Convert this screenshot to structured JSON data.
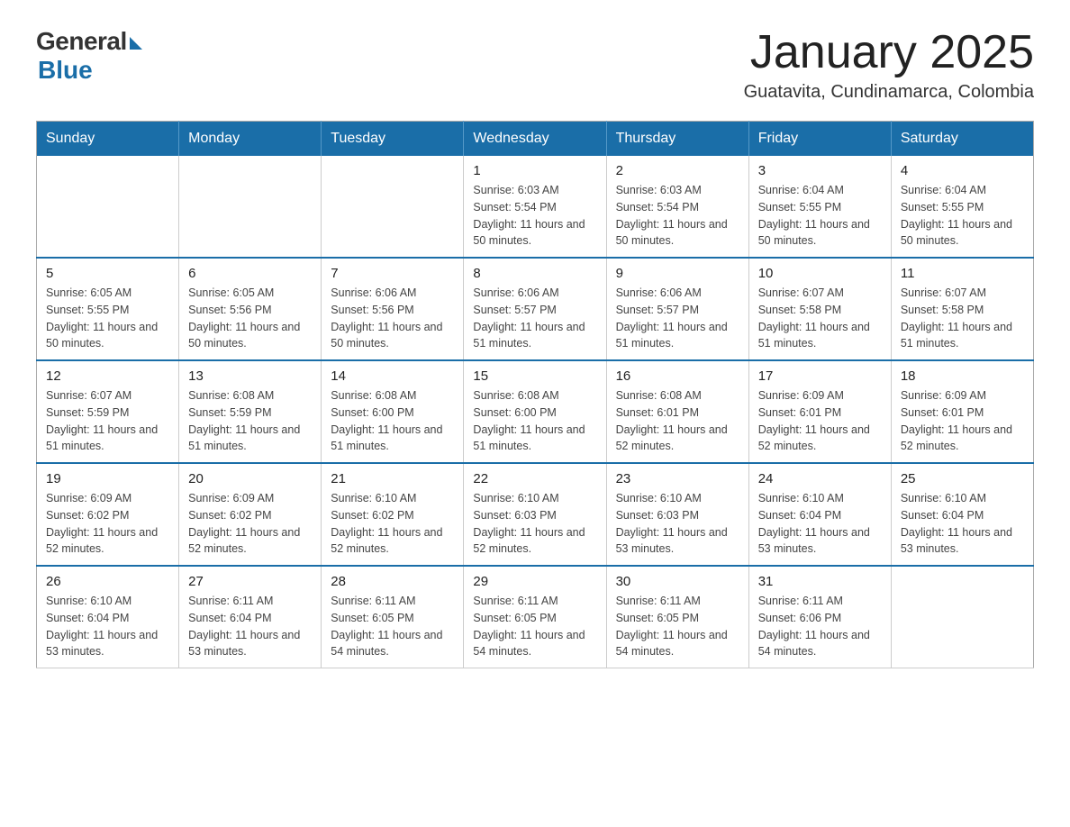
{
  "logo": {
    "general": "General",
    "blue": "Blue"
  },
  "title": "January 2025",
  "subtitle": "Guatavita, Cundinamarca, Colombia",
  "days_of_week": [
    "Sunday",
    "Monday",
    "Tuesday",
    "Wednesday",
    "Thursday",
    "Friday",
    "Saturday"
  ],
  "weeks": [
    [
      {
        "day": "",
        "info": ""
      },
      {
        "day": "",
        "info": ""
      },
      {
        "day": "",
        "info": ""
      },
      {
        "day": "1",
        "info": "Sunrise: 6:03 AM\nSunset: 5:54 PM\nDaylight: 11 hours\nand 50 minutes."
      },
      {
        "day": "2",
        "info": "Sunrise: 6:03 AM\nSunset: 5:54 PM\nDaylight: 11 hours\nand 50 minutes."
      },
      {
        "day": "3",
        "info": "Sunrise: 6:04 AM\nSunset: 5:55 PM\nDaylight: 11 hours\nand 50 minutes."
      },
      {
        "day": "4",
        "info": "Sunrise: 6:04 AM\nSunset: 5:55 PM\nDaylight: 11 hours\nand 50 minutes."
      }
    ],
    [
      {
        "day": "5",
        "info": "Sunrise: 6:05 AM\nSunset: 5:55 PM\nDaylight: 11 hours\nand 50 minutes."
      },
      {
        "day": "6",
        "info": "Sunrise: 6:05 AM\nSunset: 5:56 PM\nDaylight: 11 hours\nand 50 minutes."
      },
      {
        "day": "7",
        "info": "Sunrise: 6:06 AM\nSunset: 5:56 PM\nDaylight: 11 hours\nand 50 minutes."
      },
      {
        "day": "8",
        "info": "Sunrise: 6:06 AM\nSunset: 5:57 PM\nDaylight: 11 hours\nand 51 minutes."
      },
      {
        "day": "9",
        "info": "Sunrise: 6:06 AM\nSunset: 5:57 PM\nDaylight: 11 hours\nand 51 minutes."
      },
      {
        "day": "10",
        "info": "Sunrise: 6:07 AM\nSunset: 5:58 PM\nDaylight: 11 hours\nand 51 minutes."
      },
      {
        "day": "11",
        "info": "Sunrise: 6:07 AM\nSunset: 5:58 PM\nDaylight: 11 hours\nand 51 minutes."
      }
    ],
    [
      {
        "day": "12",
        "info": "Sunrise: 6:07 AM\nSunset: 5:59 PM\nDaylight: 11 hours\nand 51 minutes."
      },
      {
        "day": "13",
        "info": "Sunrise: 6:08 AM\nSunset: 5:59 PM\nDaylight: 11 hours\nand 51 minutes."
      },
      {
        "day": "14",
        "info": "Sunrise: 6:08 AM\nSunset: 6:00 PM\nDaylight: 11 hours\nand 51 minutes."
      },
      {
        "day": "15",
        "info": "Sunrise: 6:08 AM\nSunset: 6:00 PM\nDaylight: 11 hours\nand 51 minutes."
      },
      {
        "day": "16",
        "info": "Sunrise: 6:08 AM\nSunset: 6:01 PM\nDaylight: 11 hours\nand 52 minutes."
      },
      {
        "day": "17",
        "info": "Sunrise: 6:09 AM\nSunset: 6:01 PM\nDaylight: 11 hours\nand 52 minutes."
      },
      {
        "day": "18",
        "info": "Sunrise: 6:09 AM\nSunset: 6:01 PM\nDaylight: 11 hours\nand 52 minutes."
      }
    ],
    [
      {
        "day": "19",
        "info": "Sunrise: 6:09 AM\nSunset: 6:02 PM\nDaylight: 11 hours\nand 52 minutes."
      },
      {
        "day": "20",
        "info": "Sunrise: 6:09 AM\nSunset: 6:02 PM\nDaylight: 11 hours\nand 52 minutes."
      },
      {
        "day": "21",
        "info": "Sunrise: 6:10 AM\nSunset: 6:02 PM\nDaylight: 11 hours\nand 52 minutes."
      },
      {
        "day": "22",
        "info": "Sunrise: 6:10 AM\nSunset: 6:03 PM\nDaylight: 11 hours\nand 52 minutes."
      },
      {
        "day": "23",
        "info": "Sunrise: 6:10 AM\nSunset: 6:03 PM\nDaylight: 11 hours\nand 53 minutes."
      },
      {
        "day": "24",
        "info": "Sunrise: 6:10 AM\nSunset: 6:04 PM\nDaylight: 11 hours\nand 53 minutes."
      },
      {
        "day": "25",
        "info": "Sunrise: 6:10 AM\nSunset: 6:04 PM\nDaylight: 11 hours\nand 53 minutes."
      }
    ],
    [
      {
        "day": "26",
        "info": "Sunrise: 6:10 AM\nSunset: 6:04 PM\nDaylight: 11 hours\nand 53 minutes."
      },
      {
        "day": "27",
        "info": "Sunrise: 6:11 AM\nSunset: 6:04 PM\nDaylight: 11 hours\nand 53 minutes."
      },
      {
        "day": "28",
        "info": "Sunrise: 6:11 AM\nSunset: 6:05 PM\nDaylight: 11 hours\nand 54 minutes."
      },
      {
        "day": "29",
        "info": "Sunrise: 6:11 AM\nSunset: 6:05 PM\nDaylight: 11 hours\nand 54 minutes."
      },
      {
        "day": "30",
        "info": "Sunrise: 6:11 AM\nSunset: 6:05 PM\nDaylight: 11 hours\nand 54 minutes."
      },
      {
        "day": "31",
        "info": "Sunrise: 6:11 AM\nSunset: 6:06 PM\nDaylight: 11 hours\nand 54 minutes."
      },
      {
        "day": "",
        "info": ""
      }
    ]
  ]
}
